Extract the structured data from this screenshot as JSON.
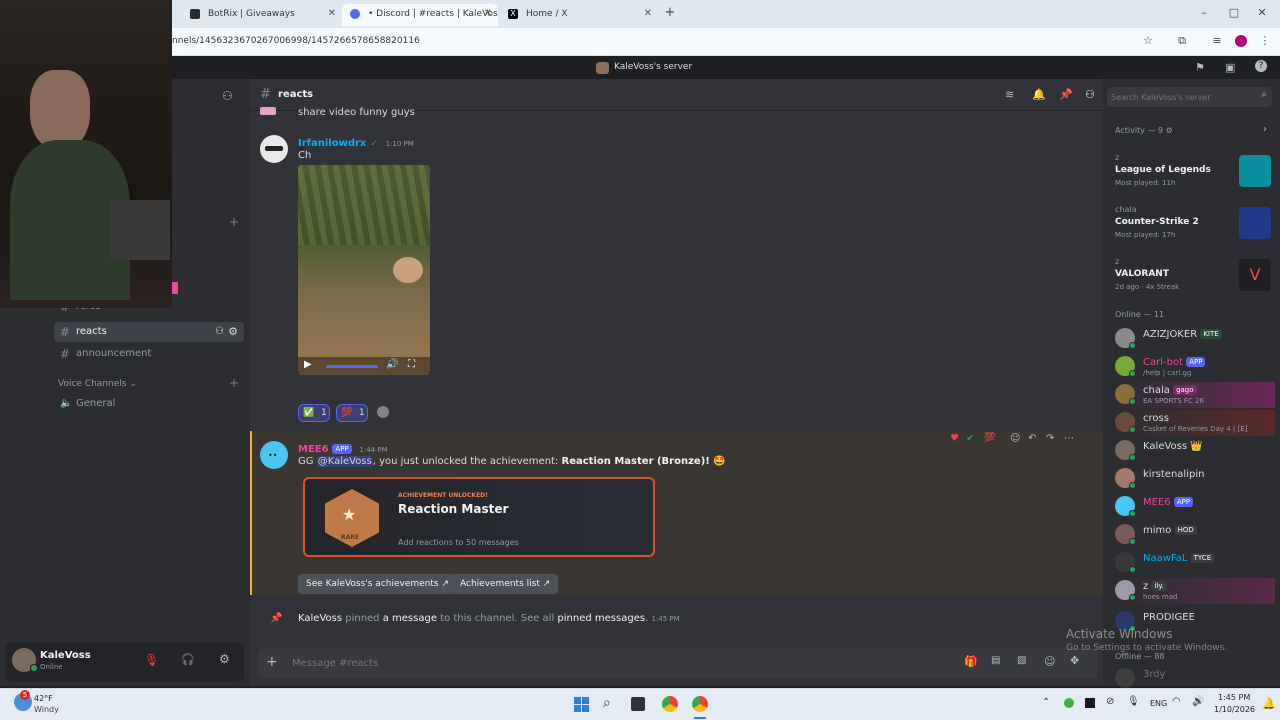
{
  "browser": {
    "tabs": [
      {
        "label": "BotRix | Giveaways",
        "active": false
      },
      {
        "label": "• Discord | #reacts | KaleVoss's s",
        "active": true
      },
      {
        "label": "Home / X",
        "active": false
      }
    ],
    "url": "nnels/1456323670267006998/1457266578658820116"
  },
  "discord": {
    "server_title": "KaleVoss's server",
    "channel_header": "reacts",
    "search_placeholder": "Search KaleVoss's server",
    "sidebar": {
      "channels": [
        {
          "label": "rules",
          "active": false
        },
        {
          "label": "reacts",
          "active": true
        },
        {
          "label": "announcement",
          "active": false
        }
      ],
      "voice_category": "Voice Channels",
      "voice_channels": [
        "General"
      ],
      "user": {
        "name": "KaleVoss",
        "status": "Online"
      }
    },
    "messages": {
      "prev_tail": "share video funny guys",
      "msg1": {
        "author": "Irfanilowdrx",
        "time": "1:10 PM",
        "text": "Ch",
        "reactions": [
          {
            "emoji": "✅",
            "count": "1"
          },
          {
            "emoji": "💯",
            "count": "1"
          }
        ]
      },
      "msg2": {
        "author": "MEE6",
        "tag": "APP",
        "time": "1:44 PM",
        "text_prefix": "GG ",
        "mention": "@KaleVoss",
        "text_mid": ", you just unlocked the achievement: ",
        "achievement_bold": "Reaction Master (Bronze)!",
        "embed": {
          "label": "ACHIEVEMENT UNLOCKED!",
          "title": "Reaction Master",
          "desc": "Add reactions to 50 messages",
          "badge": "RARE"
        },
        "buttons": [
          "See KaleVoss's achievements",
          "Achievements list"
        ]
      },
      "system": {
        "user": "KaleVoss",
        "t1": " pinned ",
        "link1": "a message",
        "t2": " to this channel. See all ",
        "link2": "pinned messages",
        "t3": ".",
        "time": "1:45 PM"
      }
    },
    "composer_placeholder": "Message #reacts",
    "members": {
      "activity_header": "Activity — 9",
      "activities": [
        {
          "who": "z",
          "game": "League of Legends",
          "meta": "Most played: 11h",
          "color": "#0a8f9d"
        },
        {
          "who": "chala",
          "game": "Counter-Strike 2",
          "meta": "Most played: 17h",
          "color": "#f0a020"
        },
        {
          "who": "z",
          "game": "VALORANT",
          "meta": "2d ago · 4x Streak",
          "color": "#ff4655"
        }
      ],
      "online_header": "Online — 11",
      "online": [
        {
          "name": "AZIZJOKER",
          "tag": "KITE",
          "sub": "",
          "color": "#dbdee1"
        },
        {
          "name": "Carl-bot",
          "tag": "APP",
          "sub": "/help | carl.gg",
          "color": "#eb459e"
        },
        {
          "name": "chala",
          "tag": "gago",
          "sub": "EA SPORTS FC 26",
          "color": "#dbdee1"
        },
        {
          "name": "cross",
          "tag": "",
          "sub": "Casket of Reveries Day 4 | [E]",
          "color": "#dbdee1"
        },
        {
          "name": "KaleVoss",
          "tag": "👑",
          "sub": "",
          "color": "#dbdee1"
        },
        {
          "name": "kirstenalipin",
          "tag": "",
          "sub": "",
          "color": "#dbdee1"
        },
        {
          "name": "MEE6",
          "tag": "APP",
          "sub": "",
          "color": "#eb459e"
        },
        {
          "name": "mimo",
          "tag": "HOD",
          "sub": "",
          "color": "#dbdee1"
        },
        {
          "name": "NaawFaL",
          "tag": "TYCE",
          "sub": "",
          "color": "#00b0f4"
        },
        {
          "name": "z",
          "tag": "ily.",
          "sub": "hoes mad",
          "color": "#dbdee1"
        },
        {
          "name": "PRODIGEE",
          "tag": "",
          "sub": "",
          "color": "#dbdee1"
        }
      ],
      "offline_header": "Offline — 88",
      "offline_first": "3rdy"
    },
    "watermark": {
      "line1": "Activate Windows",
      "line2": "Go to Settings to activate Windows."
    }
  },
  "taskbar": {
    "weather_temp": "42°F",
    "weather_desc": "Windy",
    "lang": "ENG",
    "time": "1:45 PM",
    "date": "1/10/2026"
  }
}
